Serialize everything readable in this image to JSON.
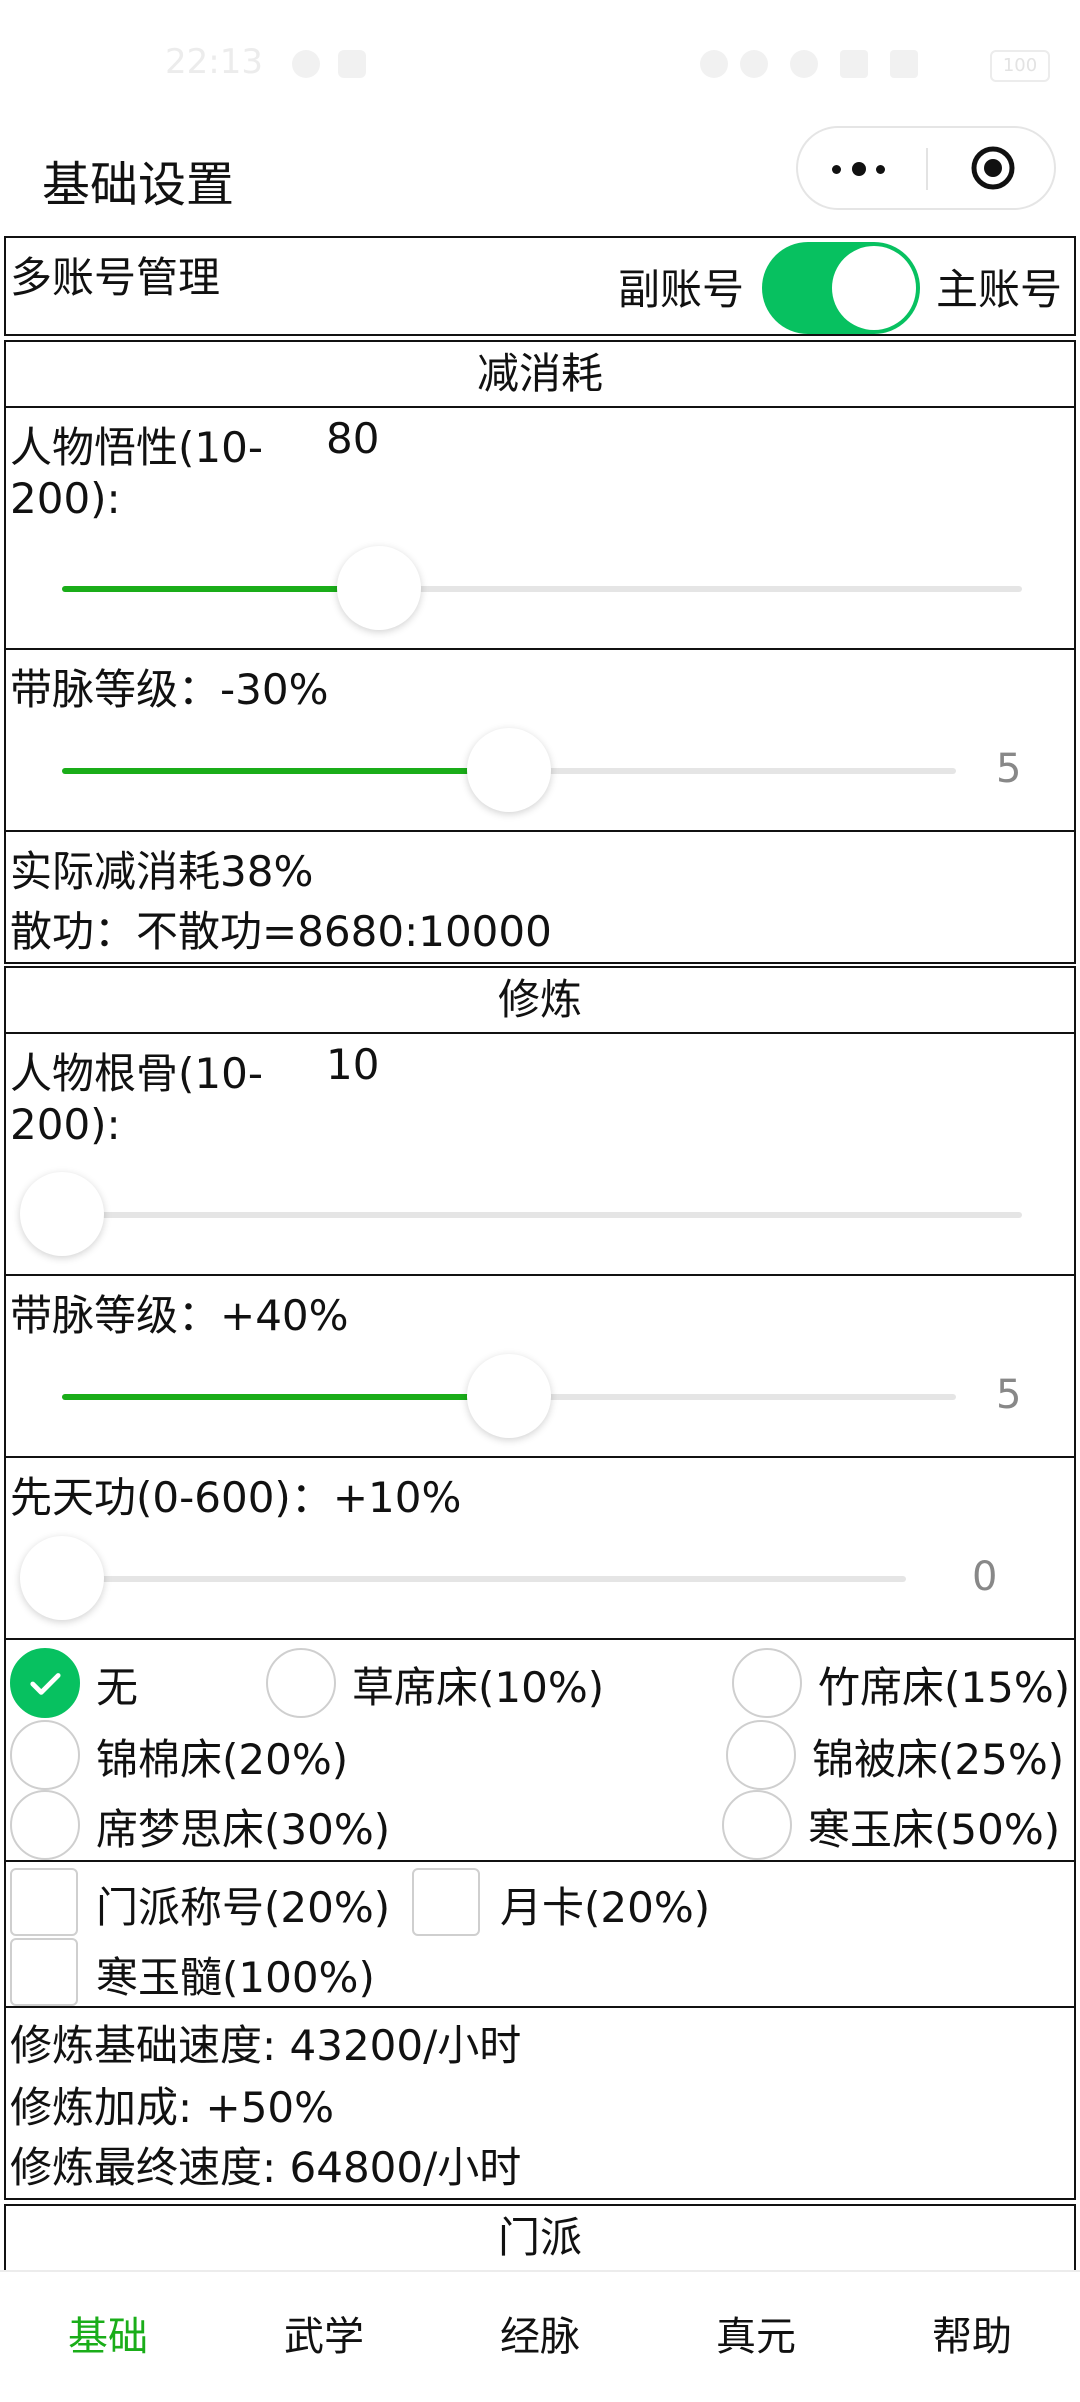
{
  "status": {
    "time": "22:13",
    "battery": "100"
  },
  "nav": {
    "title": "基础设置"
  },
  "account": {
    "label": "多账号管理",
    "left_option": "副账号",
    "right_option": "主账号",
    "toggle_on": true
  },
  "reduce": {
    "header": "减消耗",
    "wuxing_label_line1": "人物悟性(10-",
    "wuxing_label_line2": "200):",
    "wuxing_value": "80",
    "wuxing_fraction": 0.33,
    "daimai_label": "带脉等级：-30%",
    "daimai_value": "5",
    "daimai_fraction": 0.5,
    "actual": "实际减消耗38%",
    "sangong": "散功：不散功=8680:10000"
  },
  "cultivate": {
    "header": "修炼",
    "gengu_label_line1": "人物根骨(10-",
    "gengu_label_line2": "200):",
    "gengu_value": "10",
    "gengu_fraction": 0,
    "daimai_label": "带脉等级：+40%",
    "daimai_value": "5",
    "daimai_fraction": 0.5,
    "xiantian_label": "先天功(0-600)：+10%",
    "xiantian_value": "0",
    "xiantian_fraction": 0,
    "beds": [
      {
        "label": "无",
        "checked": true
      },
      {
        "label": "草席床(10%)",
        "checked": false
      },
      {
        "label": "竹席床(15%)",
        "checked": false
      },
      {
        "label": "锦棉床(20%)",
        "checked": false
      },
      {
        "label": "锦被床(25%)",
        "checked": false
      },
      {
        "label": "席梦思床(30%)",
        "checked": false
      },
      {
        "label": "寒玉床(50%)",
        "checked": false
      }
    ],
    "extras": [
      {
        "label": "门派称号(20%)",
        "checked": false
      },
      {
        "label": "月卡(20%)",
        "checked": false
      },
      {
        "label": "寒玉髓(100%)",
        "checked": false
      }
    ],
    "base_speed": "修炼基础速度: 43200/小时",
    "bonus": "修炼加成: +50%",
    "final_speed": "修炼最终速度: 64800/小时"
  },
  "sect": {
    "header": "门派"
  },
  "tabs": [
    {
      "label": "基础",
      "active": true
    },
    {
      "label": "武学",
      "active": false
    },
    {
      "label": "经脉",
      "active": false
    },
    {
      "label": "真元",
      "active": false
    },
    {
      "label": "帮助",
      "active": false
    }
  ],
  "colors": {
    "accent": "#1aad19",
    "radio_checked": "#07c160"
  }
}
